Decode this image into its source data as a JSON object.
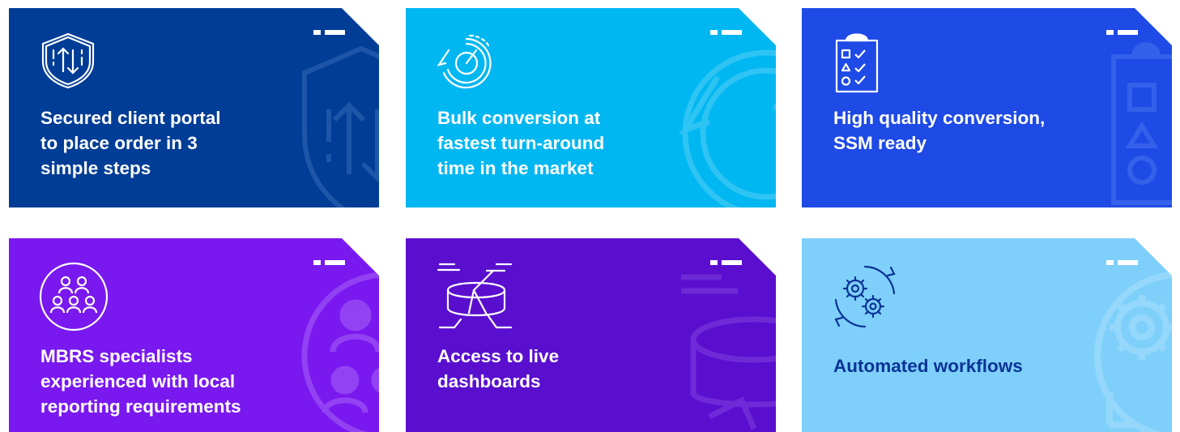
{
  "cards": [
    {
      "label": "Secured client portal\nto place order in 3\nsimple steps",
      "color": "#003d96",
      "icon": "shield-arrows-icon"
    },
    {
      "label": "Bulk conversion at\nfastest turn-around\ntime in the market",
      "color": "#00b7f1",
      "icon": "speedometer-icon"
    },
    {
      "label": "High quality conversion,\nSSM ready",
      "color": "#1e4ae6",
      "icon": "clipboard-checklist-icon"
    },
    {
      "label": "MBRS specialists\nexperienced with local\nreporting requirements",
      "color": "#7a18f0",
      "icon": "team-people-icon"
    },
    {
      "label": "Access to live\ndashboards",
      "color": "#5a0fcf",
      "icon": "pie-chart-dashboard-icon"
    },
    {
      "label": "Automated workflows",
      "color": "#7ed0fb",
      "icon": "gears-cycle-icon"
    }
  ]
}
